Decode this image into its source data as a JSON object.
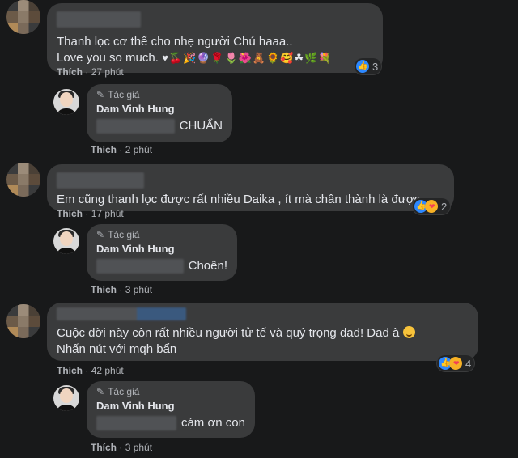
{
  "comments": [
    {
      "text_lines": [
        "Thanh lọc cơ thể cho nhẹ người Chú haaa..",
        "Love you so much."
      ],
      "emojis": "♥🍒🎉🔮🌹🌷🌺🧸🌻🥰☘🌿💐",
      "like_label": "Thích",
      "time": "27 phút",
      "reaction_count": "3",
      "reply": {
        "author_tag": "Tác giả",
        "author": "Dam Vinh Hung",
        "text": "CHUẨN",
        "like_label": "Thích",
        "time": "2 phút"
      }
    },
    {
      "text_lines": [
        "Em cũng thanh lọc được rất nhiều Daika , ít mà chân thành là được"
      ],
      "like_label": "Thích",
      "time": "17 phút",
      "reaction_count": "2",
      "reply": {
        "author_tag": "Tác giả",
        "author": "Dam Vinh Hung",
        "text": "Choên!",
        "like_label": "Thích",
        "time": "3 phút"
      }
    },
    {
      "text_lines": [
        "Cuộc đời này còn rất nhiều người tử tế và quý trọng dad! Dad à",
        "Nhấn nút với mqh bẩn"
      ],
      "like_label": "Thích",
      "time": "42 phút",
      "reaction_count": "4",
      "reply": {
        "author_tag": "Tác giả",
        "author": "Dam Vinh Hung",
        "text": "cám ơn con",
        "like_label": "Thích",
        "time": "3 phút"
      }
    }
  ]
}
